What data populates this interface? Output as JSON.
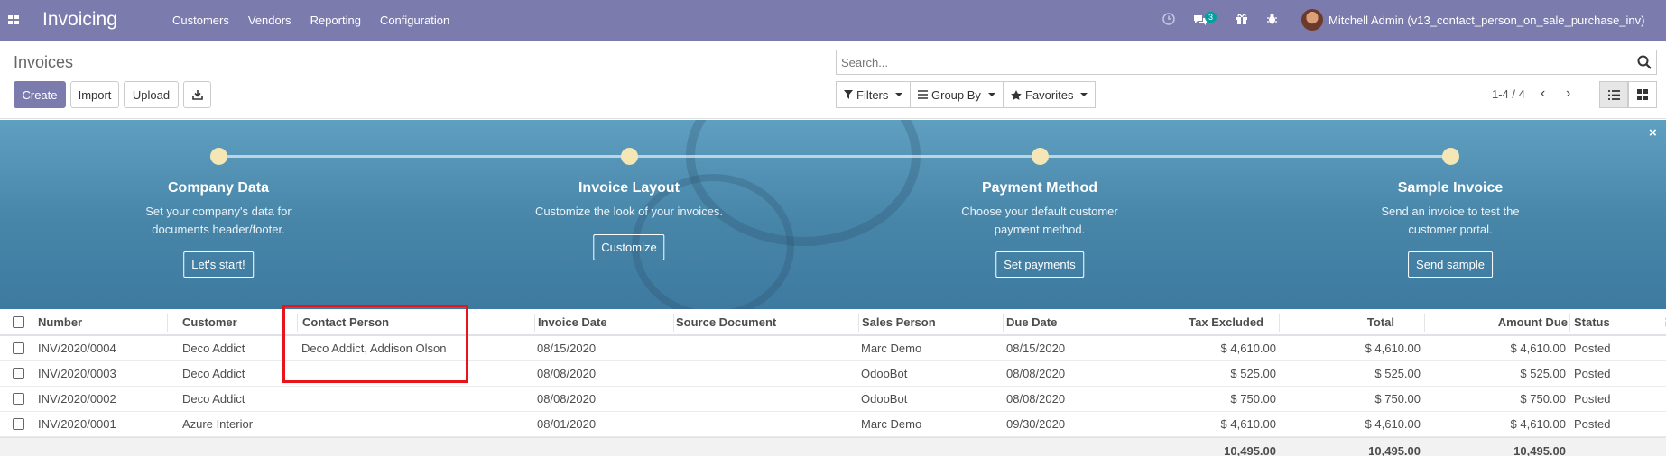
{
  "navbar": {
    "brand": "Invoicing",
    "menu": [
      "Customers",
      "Vendors",
      "Reporting",
      "Configuration"
    ],
    "chat_badge": "3",
    "user": "Mitchell Admin (v13_contact_person_on_sale_purchase_inv)"
  },
  "control_panel": {
    "breadcrumb": "Invoices",
    "create": "Create",
    "import": "Import",
    "upload": "Upload",
    "search_placeholder": "Search...",
    "filters": "Filters",
    "group_by": "Group By",
    "favorites": "Favorites",
    "pager": "1-4 / 4"
  },
  "banner": {
    "steps": [
      {
        "title": "Company Data",
        "desc1": "Set your company's data for",
        "desc2": "documents header/footer.",
        "button": "Let's start!"
      },
      {
        "title": "Invoice Layout",
        "desc1": "Customize the look of your invoices.",
        "desc2": "",
        "button": "Customize"
      },
      {
        "title": "Payment Method",
        "desc1": "Choose your default customer",
        "desc2": "payment method.",
        "button": "Set payments"
      },
      {
        "title": "Sample Invoice",
        "desc1": "Send an invoice to test the",
        "desc2": "customer portal.",
        "button": "Send sample"
      }
    ],
    "close": "×"
  },
  "table": {
    "headers": [
      "Number",
      "Customer",
      "Contact Person",
      "Invoice Date",
      "Source Document",
      "Sales Person",
      "Due Date",
      "Tax Excluded",
      "Total",
      "Amount Due",
      "Status"
    ],
    "rows": [
      [
        "INV/2020/0004",
        "Deco Addict",
        "Deco Addict, Addison Olson",
        "08/15/2020",
        "",
        "Marc Demo",
        "08/15/2020",
        "$ 4,610.00",
        "$ 4,610.00",
        "$ 4,610.00",
        "Posted"
      ],
      [
        "INV/2020/0003",
        "Deco Addict",
        "",
        "08/08/2020",
        "",
        "OdooBot",
        "08/08/2020",
        "$ 525.00",
        "$ 525.00",
        "$ 525.00",
        "Posted"
      ],
      [
        "INV/2020/0002",
        "Deco Addict",
        "",
        "08/08/2020",
        "",
        "OdooBot",
        "08/08/2020",
        "$ 750.00",
        "$ 750.00",
        "$ 750.00",
        "Posted"
      ],
      [
        "INV/2020/0001",
        "Azure Interior",
        "",
        "08/01/2020",
        "",
        "Marc Demo",
        "09/30/2020",
        "$ 4,610.00",
        "$ 4,610.00",
        "$ 4,610.00",
        "Posted"
      ]
    ],
    "totals": {
      "tax_excluded": "10,495.00",
      "total": "10,495.00",
      "amount_due": "10,495.00"
    }
  },
  "colors": {
    "navbar": "#7c7bad",
    "banner": "#4785a8",
    "highlight": "#e8131b",
    "badge": "#00a09d"
  }
}
